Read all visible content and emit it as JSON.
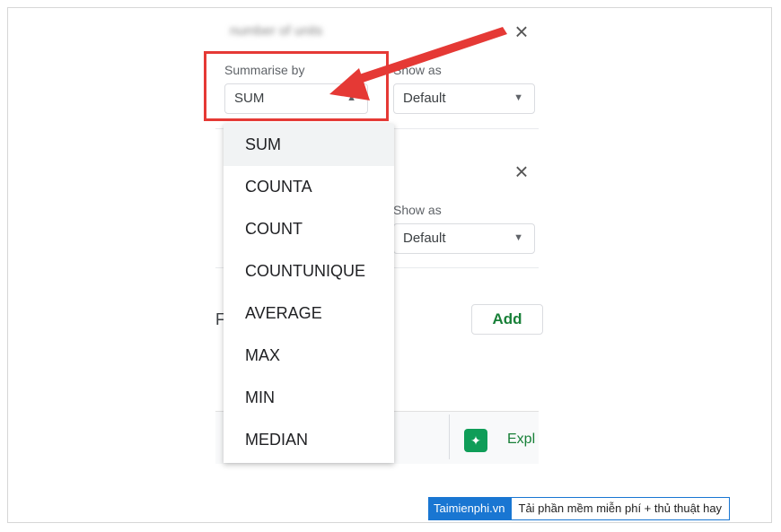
{
  "panel": {
    "value_field_name": "number of units",
    "summarise_label": "Summarise by",
    "summarise_value": "SUM",
    "show_as_label": "Show as",
    "show_as_value": "Default",
    "show_as_label_2": "Show as",
    "show_as_value_2": "Default",
    "filters_letter": "F",
    "add_button": "Add",
    "explore_label": "Expl"
  },
  "dropdown": {
    "items": [
      "SUM",
      "COUNTA",
      "COUNT",
      "COUNTUNIQUE",
      "AVERAGE",
      "MAX",
      "MIN",
      "MEDIAN"
    ],
    "selected_index": 0
  },
  "brand": {
    "name": "Taimienphi.vn",
    "slogan": "Tải phần mềm miễn phí + thủ thuật hay"
  },
  "colors": {
    "highlight": "#e53935",
    "add_button_text": "#188038",
    "brand_blue": "#1976d2"
  },
  "icons": [
    "close-icon",
    "dropdown-caret-icon",
    "explore-icon",
    "annotation-arrow"
  ]
}
